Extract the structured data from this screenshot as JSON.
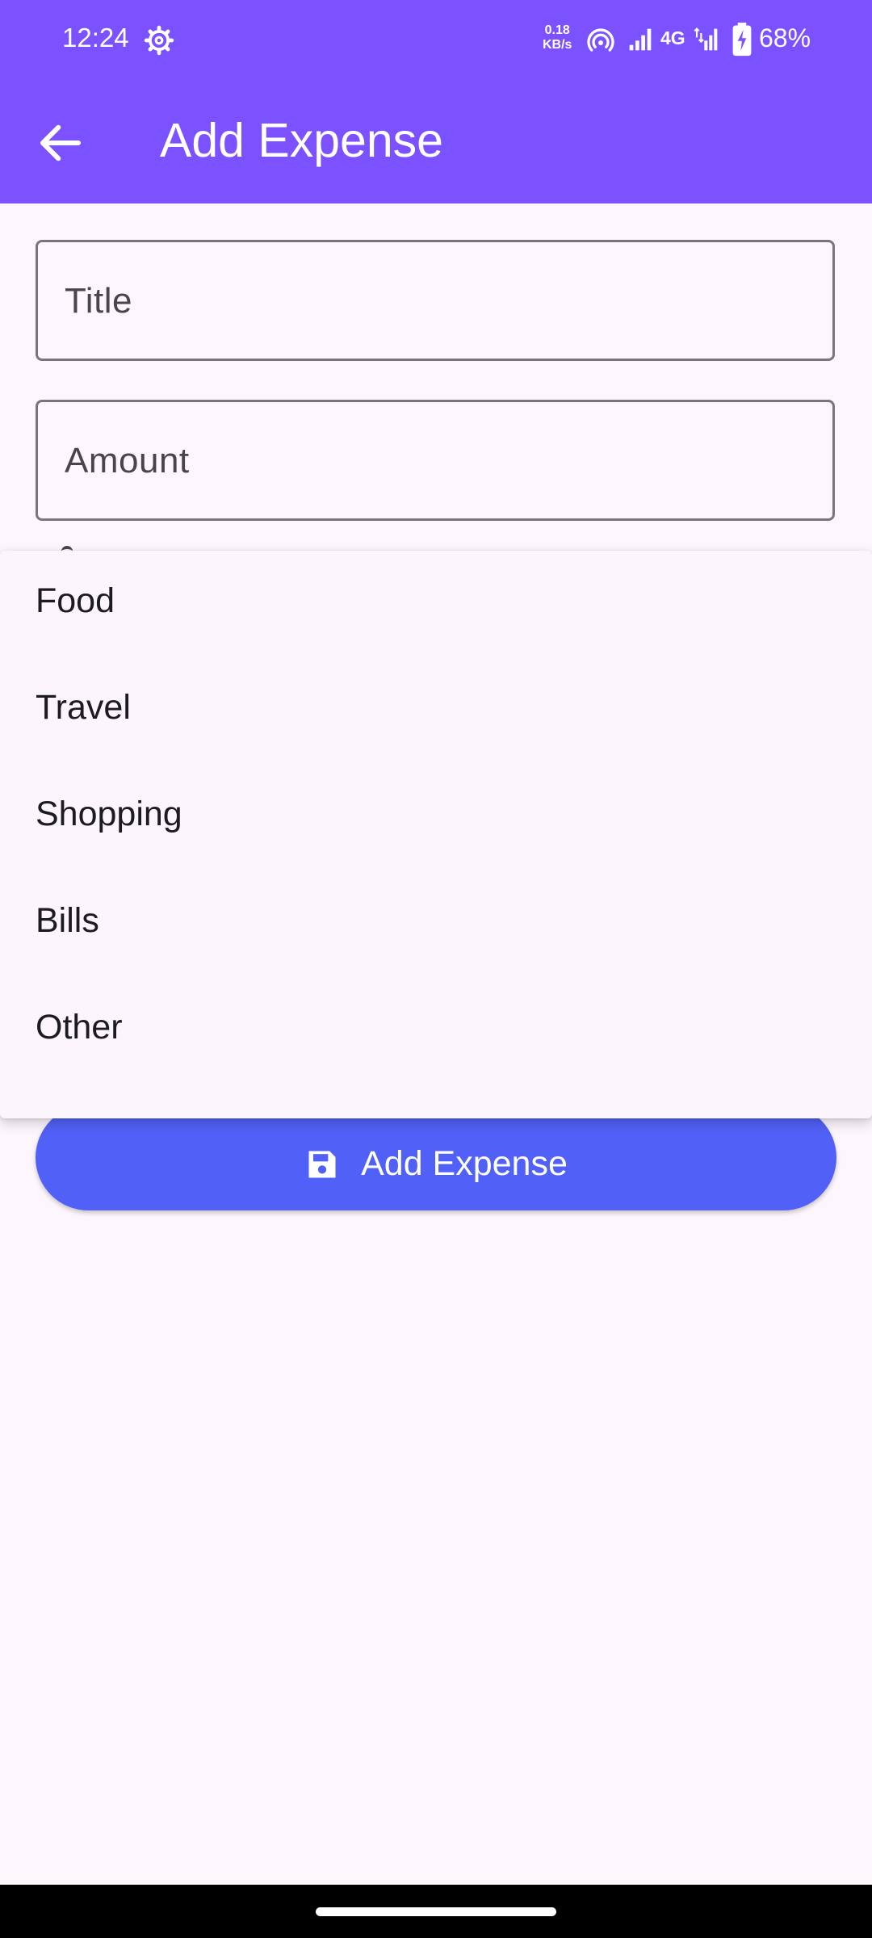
{
  "status_bar": {
    "time": "12:24",
    "net_speed_value": "0.18",
    "net_speed_unit": "KB/s",
    "network_type": "4G",
    "battery": "68%"
  },
  "app_bar": {
    "title": "Add Expense"
  },
  "form": {
    "title_label": "Title",
    "amount_label": "Amount"
  },
  "category_menu": {
    "items": [
      {
        "label": "Food"
      },
      {
        "label": "Travel"
      },
      {
        "label": "Shopping"
      },
      {
        "label": "Bills"
      },
      {
        "label": "Other"
      }
    ]
  },
  "submit_button": {
    "label": "Add Expense",
    "icon": "save-icon"
  },
  "colors": {
    "app_bar": "#7C51FF",
    "button": "#5160F6",
    "background": "#FDF7FD"
  }
}
